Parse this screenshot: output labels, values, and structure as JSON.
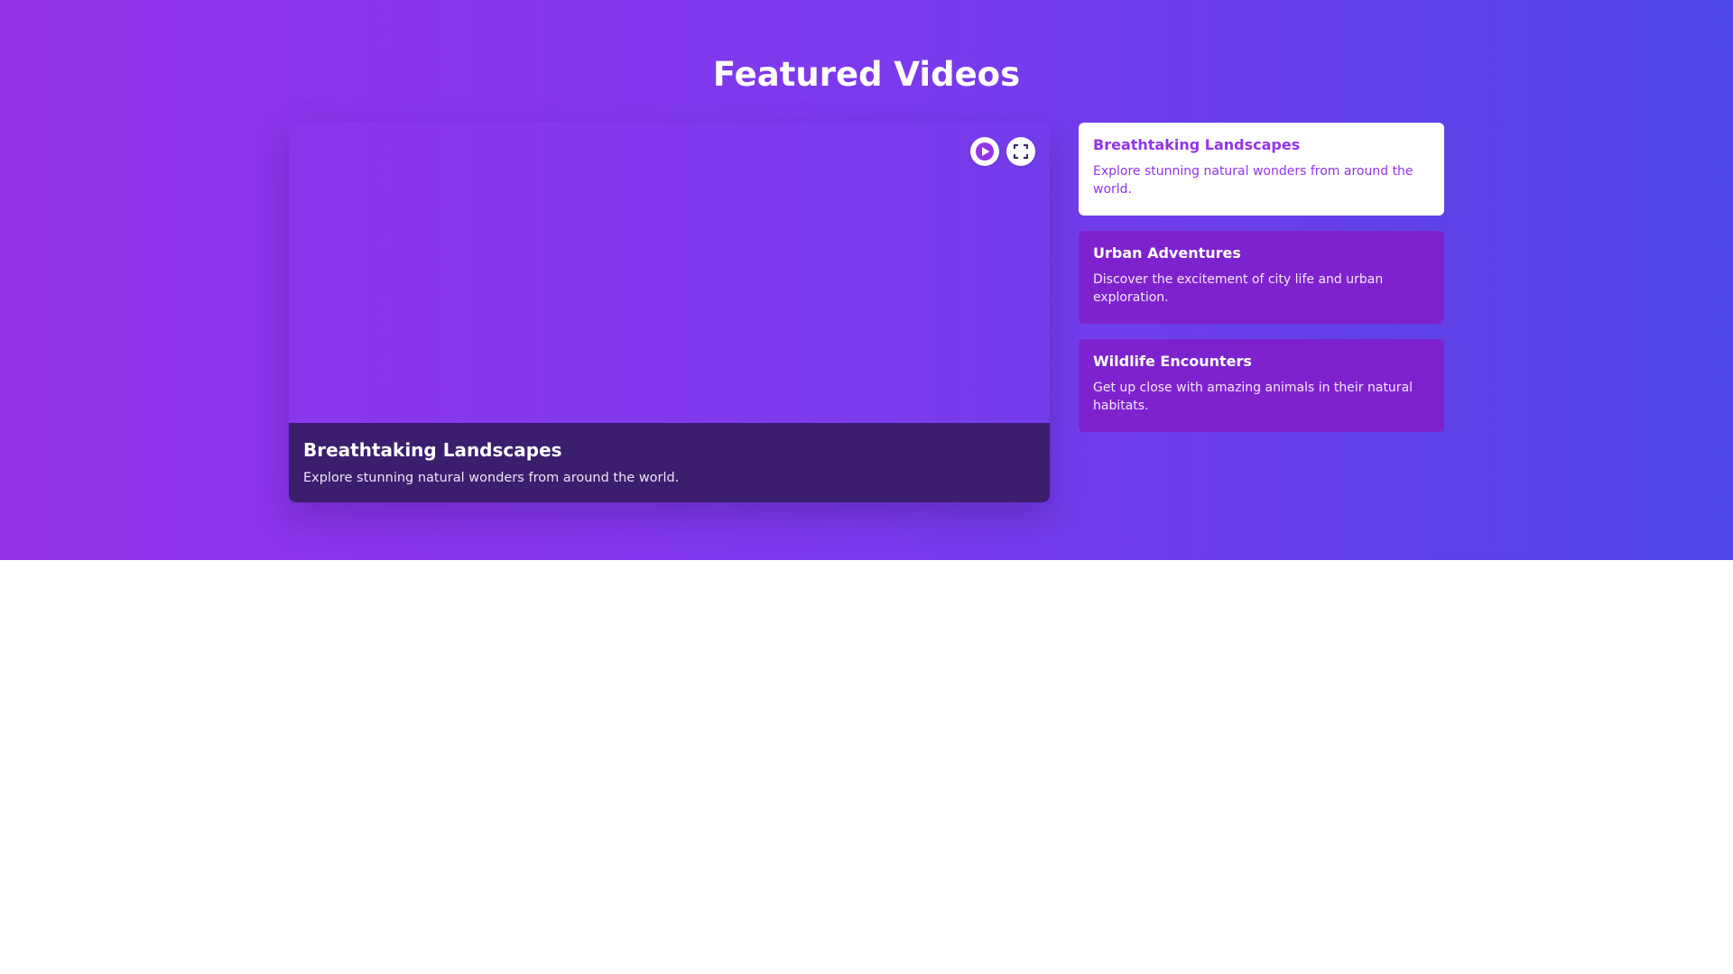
{
  "page": {
    "title": "Featured Videos"
  },
  "player": {
    "title": "Breathtaking Landscapes",
    "description": "Explore stunning natural wonders from around the world.",
    "controls": {
      "play_icon": "play-icon",
      "fullscreen_icon": "fullscreen-icon"
    }
  },
  "playlist": {
    "items": [
      {
        "title": "Breathtaking Landscapes",
        "description": "Explore stunning natural wonders from around the world.",
        "active": true
      },
      {
        "title": "Urban Adventures",
        "description": "Discover the excitement of city life and urban exploration.",
        "active": false
      },
      {
        "title": "Wildlife Encounters",
        "description": "Get up close with amazing animals in their natural habitats.",
        "active": false
      }
    ]
  },
  "colors": {
    "gradient_start": "#9333ea",
    "gradient_end": "#4f46e5",
    "info_bar": "#3b1f6e",
    "playlist_item": "#7e22ce",
    "active_item": "#ffffff",
    "active_text": "#9333ea"
  }
}
